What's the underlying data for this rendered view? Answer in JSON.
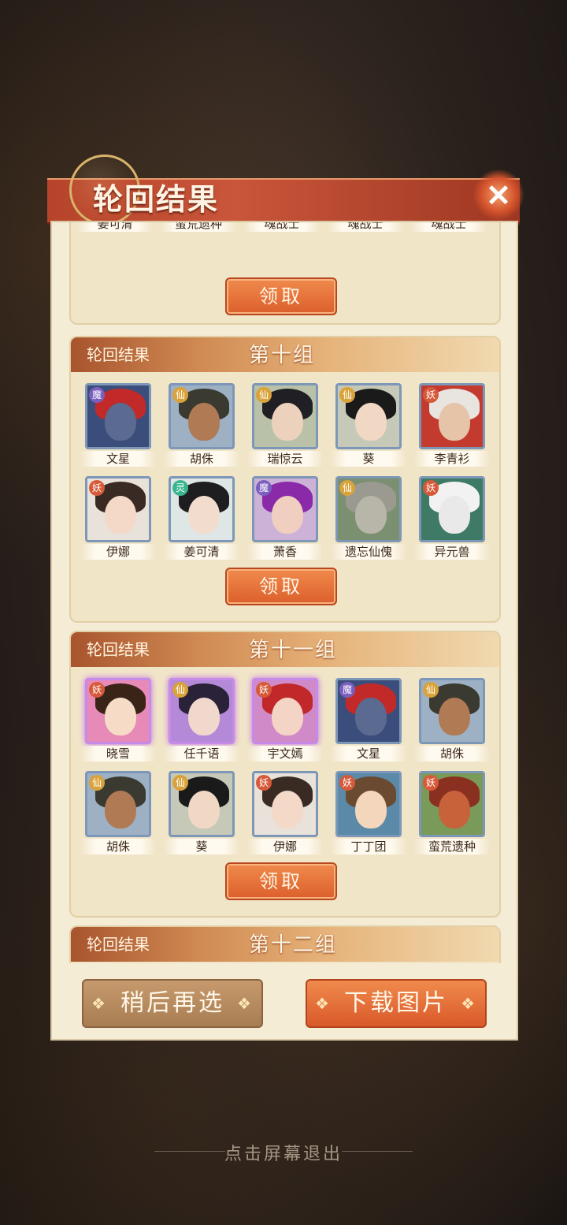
{
  "title": "轮回结果",
  "close_icon": "✕",
  "prev_group_names": [
    "姜可清",
    "蛮荒遗种",
    "魂战士",
    "魂战士",
    "魂战士"
  ],
  "claim_label": "领取",
  "groups": [
    {
      "label": "轮回结果",
      "title": "第十组",
      "cards": [
        {
          "name": "文星",
          "badge": "魔",
          "badge_color": "#7b5fbf",
          "hair": "#c22a2a",
          "skin": "#5a6a90",
          "bg": "#3b4d7a",
          "frame": "blue"
        },
        {
          "name": "胡侏",
          "badge": "仙",
          "badge_color": "#d9a23a",
          "hair": "#3a3a30",
          "skin": "#b07a55",
          "bg": "#9eb0c4",
          "frame": "blue"
        },
        {
          "name": "瑞惊云",
          "badge": "仙",
          "badge_color": "#d9a23a",
          "hair": "#1f1f24",
          "skin": "#ecd2bd",
          "bg": "#b9c2a8",
          "frame": "blue"
        },
        {
          "name": "葵",
          "badge": "仙",
          "badge_color": "#d9a23a",
          "hair": "#1a1a1a",
          "skin": "#f0d8c4",
          "bg": "#c6c9b8",
          "frame": "blue"
        },
        {
          "name": "李青衫",
          "badge": "妖",
          "badge_color": "#d65a3a",
          "hair": "#e8e4e0",
          "skin": "#e6c4a8",
          "bg": "#c23b2e",
          "frame": "blue"
        },
        {
          "name": "伊娜",
          "badge": "妖",
          "badge_color": "#d65a3a",
          "hair": "#3a2a24",
          "skin": "#f4d8c8",
          "bg": "#e8e2da",
          "frame": "blue"
        },
        {
          "name": "姜可清",
          "badge": "灵",
          "badge_color": "#3ab58f",
          "hair": "#1e1e20",
          "skin": "#f2dccd",
          "bg": "#dfe6e6",
          "frame": "blue"
        },
        {
          "name": "萧香",
          "badge": "魔",
          "badge_color": "#7b5fbf",
          "hair": "#8a2aa8",
          "skin": "#f0cfc0",
          "bg": "#cdb2d8",
          "frame": "blue"
        },
        {
          "name": "遗忘仙傀",
          "badge": "仙",
          "badge_color": "#d9a23a",
          "hair": "#9a9a90",
          "skin": "#b8b6a8",
          "bg": "#7a9070",
          "frame": "blue"
        },
        {
          "name": "异元兽",
          "badge": "妖",
          "badge_color": "#d65a3a",
          "hair": "#f2f2f2",
          "skin": "#e9e9e9",
          "bg": "#3f7a66",
          "frame": "blue"
        }
      ]
    },
    {
      "label": "轮回结果",
      "title": "第十一组",
      "cards": [
        {
          "name": "晓雪",
          "badge": "妖",
          "badge_color": "#d65a3a",
          "hair": "#3a2418",
          "skin": "#f6dcc6",
          "bg": "#e78ab8",
          "frame": "purple"
        },
        {
          "name": "任千语",
          "badge": "仙",
          "badge_color": "#d9a23a",
          "hair": "#2a2238",
          "skin": "#f0d8cc",
          "bg": "#b48ad8",
          "frame": "purple"
        },
        {
          "name": "宇文嫣",
          "badge": "妖",
          "badge_color": "#d65a3a",
          "hair": "#c0282a",
          "skin": "#f4d4c4",
          "bg": "#d08ac8",
          "frame": "purple"
        },
        {
          "name": "文星",
          "badge": "魔",
          "badge_color": "#7b5fbf",
          "hair": "#c22a2a",
          "skin": "#5a6a90",
          "bg": "#3b4d7a",
          "frame": "blue"
        },
        {
          "name": "胡侏",
          "badge": "仙",
          "badge_color": "#d9a23a",
          "hair": "#3a3a30",
          "skin": "#b07a55",
          "bg": "#9eb0c4",
          "frame": "blue"
        },
        {
          "name": "胡侏",
          "badge": "仙",
          "badge_color": "#d9a23a",
          "hair": "#3a3a30",
          "skin": "#b07a55",
          "bg": "#9eb0c4",
          "frame": "blue"
        },
        {
          "name": "葵",
          "badge": "仙",
          "badge_color": "#d9a23a",
          "hair": "#1a1a1a",
          "skin": "#f0d8c4",
          "bg": "#c6c9b8",
          "frame": "blue"
        },
        {
          "name": "伊娜",
          "badge": "妖",
          "badge_color": "#d65a3a",
          "hair": "#3a2a24",
          "skin": "#f4d8c8",
          "bg": "#e8e2da",
          "frame": "blue"
        },
        {
          "name": "丁丁团",
          "badge": "妖",
          "badge_color": "#d65a3a",
          "hair": "#6a4a30",
          "skin": "#f4d6bc",
          "bg": "#5a8aa8",
          "frame": "blue"
        },
        {
          "name": "蛮荒遗种",
          "badge": "妖",
          "badge_color": "#d65a3a",
          "hair": "#8a3020",
          "skin": "#c8623a",
          "bg": "#7a9a5a",
          "frame": "blue"
        }
      ]
    },
    {
      "label": "轮回结果",
      "title": "第十二组",
      "cards": []
    }
  ],
  "buttons": {
    "later": "稍后再选",
    "download": "下载图片",
    "diamond": "❖"
  },
  "exit_hint": "点击屏幕退出"
}
